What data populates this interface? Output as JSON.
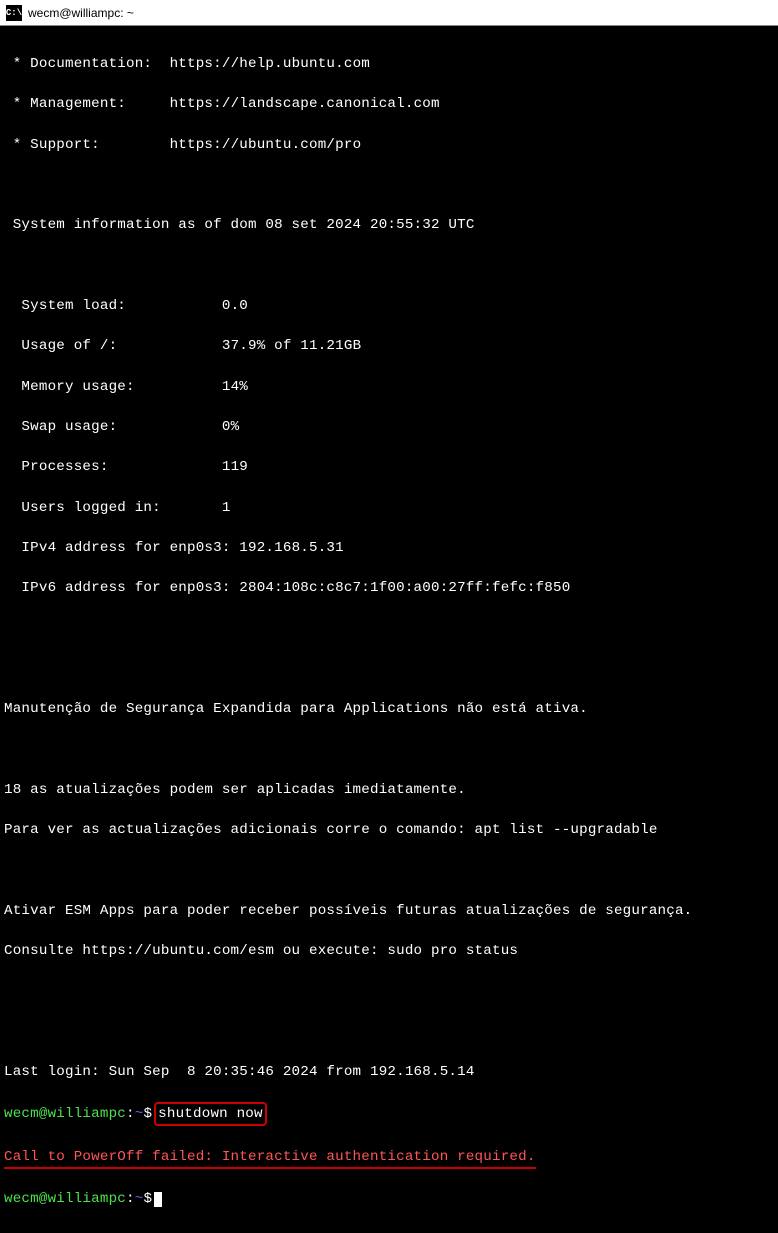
{
  "window": {
    "title": "wecm@williampc: ~",
    "icon_label": "C:\\"
  },
  "motd": {
    "doc_label": " * Documentation:  ",
    "doc_url": "https://help.ubuntu.com",
    "mgmt_label": " * Management:     ",
    "mgmt_url": "https://landscape.canonical.com",
    "support_label": " * Support:        ",
    "support_url": "https://ubuntu.com/pro",
    "sysinfo_header": " System information as of dom 08 set 2024 20:55:32 UTC",
    "stats": {
      "load_label": "  System load:           ",
      "load_val": "0.0",
      "disk_label": "  Usage of /:            ",
      "disk_val": "37.9% of 11.21GB",
      "mem_label": "  Memory usage:          ",
      "mem_val": "14%",
      "swap_label": "  Swap usage:            ",
      "swap_val": "0%",
      "proc_label": "  Processes:             ",
      "proc_val": "119",
      "users_label": "  Users logged in:       ",
      "users_val": "1",
      "ipv4_label": "  IPv4 address for enp0s3: ",
      "ipv4_val": "192.168.5.31",
      "ipv6_label": "  IPv6 address for enp0s3: ",
      "ipv6_val": "2804:108c:c8c7:1f00:a00:27ff:fefc:f850"
    },
    "esm_notice": "Manutenção de Segurança Expandida para Applications não está ativa.",
    "updates_line1": "18 as atualizações podem ser aplicadas imediatamente.",
    "updates_line2": "Para ver as actualizações adicionais corre o comando: apt list --upgradable",
    "esm_enable1": "Ativar ESM Apps para poder receber possíveis futuras atualizações de segurança.",
    "esm_enable2": "Consulte https://ubuntu.com/esm ou execute: sudo pro status",
    "last_login": "Last login: Sun Sep  8 20:35:46 2024 from 192.168.5.14"
  },
  "prompt": {
    "userhost": "wecm@williampc",
    "colon": ":",
    "path": "~",
    "dollar": "$",
    "command1": "shutdown now",
    "error": "Call to PowerOff failed: Interactive authentication required."
  }
}
